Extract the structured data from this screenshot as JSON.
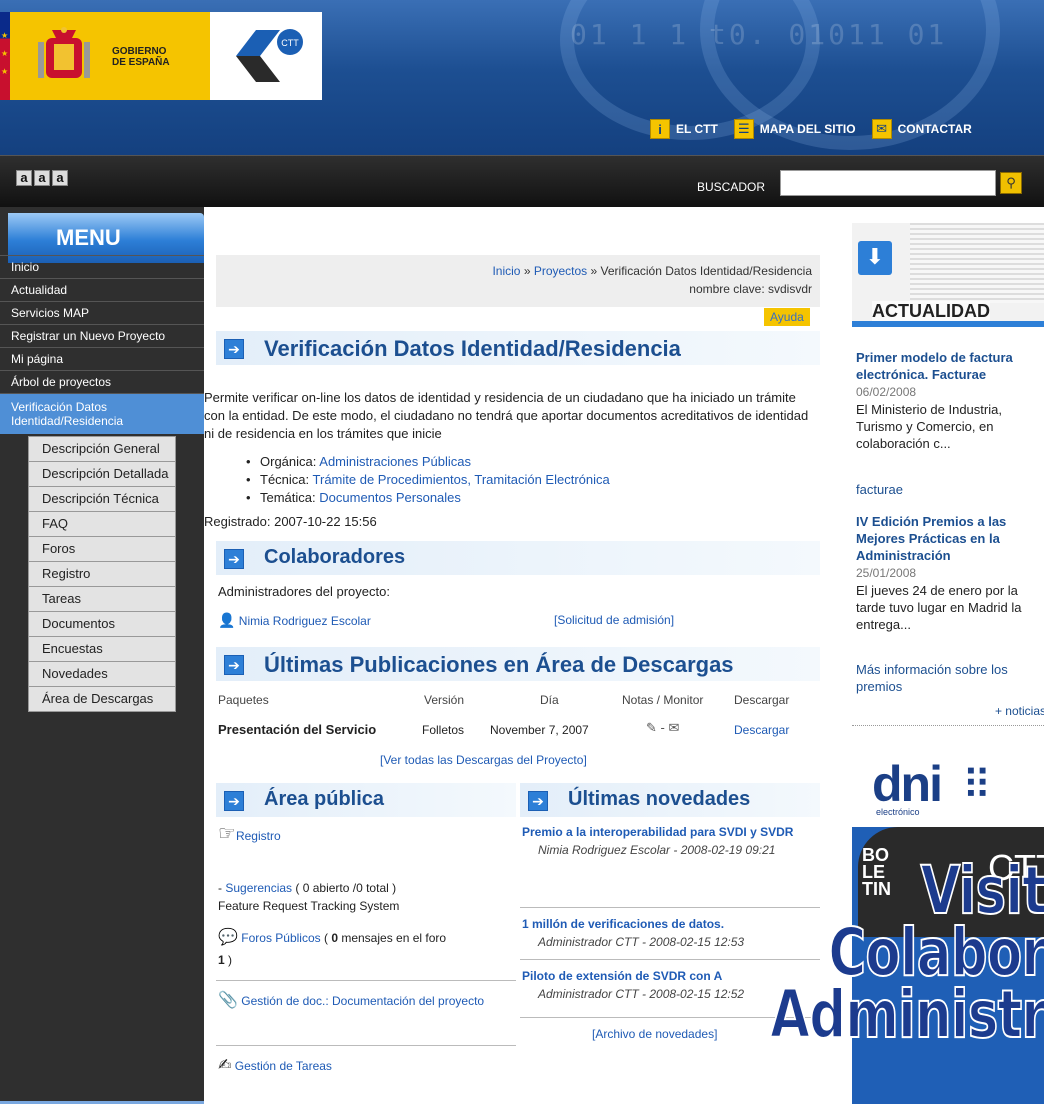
{
  "header": {
    "gov_line1": "GOBIERNO",
    "gov_line2": "DE ESPAÑA",
    "ctt_logo_text": "CTT",
    "nav": [
      {
        "icon": "info-icon",
        "label": "EL CTT"
      },
      {
        "icon": "sitemap-icon",
        "label": "MAPA DEL SITIO"
      },
      {
        "icon": "mail-icon",
        "label": "CONTACTAR"
      }
    ]
  },
  "toolbar": {
    "font_sizes": [
      "a",
      "a",
      "a"
    ],
    "search_label": "BUSCADOR",
    "search_value": ""
  },
  "sidebar": {
    "title": "MENU",
    "items": [
      {
        "label": "Inicio"
      },
      {
        "label": "Actualidad"
      },
      {
        "label": "Servicios MAP"
      },
      {
        "label": "Registrar un Nuevo Proyecto"
      },
      {
        "label": "Mi página"
      },
      {
        "label": "Árbol de proyectos"
      },
      {
        "label": "Verificación Datos Identidad/Residencia"
      }
    ],
    "subitems": [
      {
        "label": "Descripción General"
      },
      {
        "label": "Descripción Detallada"
      },
      {
        "label": "Descripción Técnica"
      },
      {
        "label": "FAQ"
      },
      {
        "label": "Foros"
      },
      {
        "label": "Registro"
      },
      {
        "label": "Tareas"
      },
      {
        "label": "Documentos"
      },
      {
        "label": "Encuestas"
      },
      {
        "label": "Novedades"
      },
      {
        "label": "Área de Descargas"
      }
    ]
  },
  "main": {
    "breadcrumb": {
      "home": "Inicio",
      "sep1": " » ",
      "projects": "Proyectos",
      "current": " » Verificación Datos Identidad/Residencia",
      "codename": "nombre clave: svdisvdr"
    },
    "help_label": "Ayuda",
    "title": "Verificación Datos Identidad/Residencia",
    "description": "Permite verificar on-line los datos de identidad y residencia de un ciudadano que ha iniciado un trámite con la entidad. De este modo, el ciudadano no tendrá que aportar documentos acreditativos de identidad ni de residencia en los trámites que inicie",
    "categories": [
      {
        "key": "Orgánica:",
        "value": "Administraciones Públicas"
      },
      {
        "key": "Técnica:",
        "value": "Trámite de Procedimientos, Tramitación Electrónica"
      },
      {
        "key": "Temática:",
        "value": "Documentos Personales"
      }
    ],
    "registered": "Registrado: 2007-10-22 15:56",
    "collaborators": {
      "title": "Colaboradores",
      "admins_label": "Administradores del proyecto:",
      "admin_name": "Nimia Rodriguez Escolar",
      "request_link": "[Solicitud de admisión]"
    },
    "downloads": {
      "title": "Últimas Publicaciones en Área de Descargas",
      "headers": [
        "Paquetes",
        "Versión",
        "Día",
        "Notas / Monitor",
        "Descargar"
      ],
      "row": {
        "package": "Presentación del Servicio",
        "version": "Folletos",
        "day": "November 7, 2007",
        "notes_sep": "-",
        "download": "Descargar"
      },
      "all_link": "[Ver todas las Descargas del Proyecto]"
    },
    "public_area": {
      "title": "Área pública",
      "registro": "Registro",
      "sug_prefix": " - ",
      "sug_link": "Sugerencias",
      "sug_counts": " ( 0 abierto /0 total )",
      "sug_desc": "Feature Request Tracking System",
      "forums_link": "Foros Públicos",
      "forums_open": " ( ",
      "forums_count": "0",
      "forums_mid": " mensajes en el foro",
      "forums_n": "1",
      "forums_close": " )",
      "docs_link": "Gestión de doc.: Documentación del proyecto",
      "tasks_link": "Gestión de Tareas"
    },
    "news": {
      "title": "Últimas novedades",
      "items": [
        {
          "title": "Premio a la interoperabilidad para SVDI y SVDR",
          "meta": "Nimia Rodriguez Escolar - 2008-02-19 09:21"
        },
        {
          "title": "1 millón de verificaciones de datos.",
          "meta": "Administrador CTT - 2008-02-15 12:53"
        },
        {
          "title": "Piloto de extensión de SVDR con A",
          "meta": "Administrador CTT - 2008-02-15 12:52"
        }
      ],
      "archive_link": "[Archivo de novedades]"
    }
  },
  "right": {
    "banner_label": "ACTUALIDAD",
    "news": [
      {
        "title": "Primer modelo de factura electrónica. Facturae",
        "date": "06/02/2008",
        "body": "El Ministerio de Industria, Turismo y Comercio, en colaboración c...",
        "tag": "facturae"
      },
      {
        "title": "IV Edición Premios a las Mejores Prácticas en la Administración",
        "date": "25/01/2008",
        "body": "El jueves 24 de enero por la tarde tuvo lugar en Madrid la entrega...",
        "tag": "Más información sobre los premios"
      }
    ],
    "more_news": "+ noticias",
    "dni_text": "dni",
    "dni_sub": "electrónico",
    "boletin_text": "BO LE TIN",
    "boletin_ctt": "CTT",
    "promo_lines": [
      "Visita",
      "Colabora",
      "Administra"
    ]
  },
  "colors": {
    "accent": "#2d7fd7",
    "heading": "#1c4f90",
    "link": "#1f5bb5",
    "gov_yellow": "#f5c400",
    "sidebar_bg": "#2f2f2f"
  }
}
